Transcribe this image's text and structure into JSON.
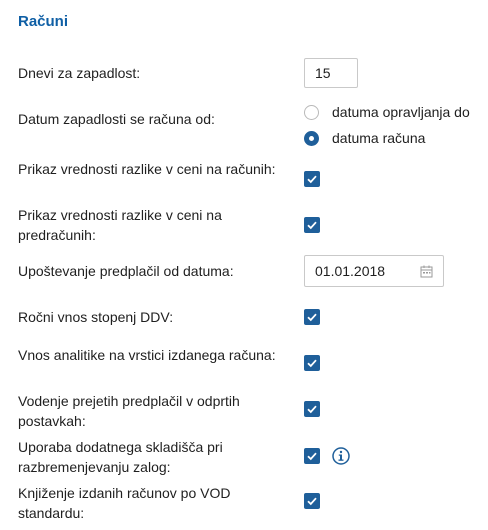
{
  "section_title": "Računi",
  "due_days": {
    "label": "Dnevi za zapadlost:",
    "value": "15"
  },
  "due_from": {
    "label": "Datum zapadlosti se računa od:",
    "options": [
      "datuma opravljanja do",
      "datuma računa"
    ],
    "selected": "datuma računa"
  },
  "price_diff_invoices": {
    "label": "Prikaz vrednosti razlike v ceni na računih:",
    "checked": true
  },
  "price_diff_proforma": {
    "label": "Prikaz vrednosti razlike v ceni na predračunih:",
    "checked": true
  },
  "prepayments_from": {
    "label": "Upoštevanje predplačil od datuma:",
    "value": "01.01.2018",
    "icon": "calendar-icon"
  },
  "manual_vat": {
    "label": "Ročni vnos stopenj DDV:",
    "checked": true
  },
  "analytics_row": {
    "label": "Vnos analitike na vrstici izdanega računa:",
    "checked": true
  },
  "open_prepayments": {
    "label": "Vodenje prejetih predplačil v odprtih postavkah:",
    "checked": true
  },
  "extra_warehouse": {
    "label": "Uporaba dodatnega skladišča pri razbremenjevanju zalog:",
    "checked": true,
    "info_icon": "info-icon"
  },
  "vod_posting": {
    "label": "Knjiženje izdanih računov po VOD standardu:",
    "checked": true
  },
  "colors": {
    "accent": "#1f5f9a",
    "title": "#0f5fa5"
  }
}
